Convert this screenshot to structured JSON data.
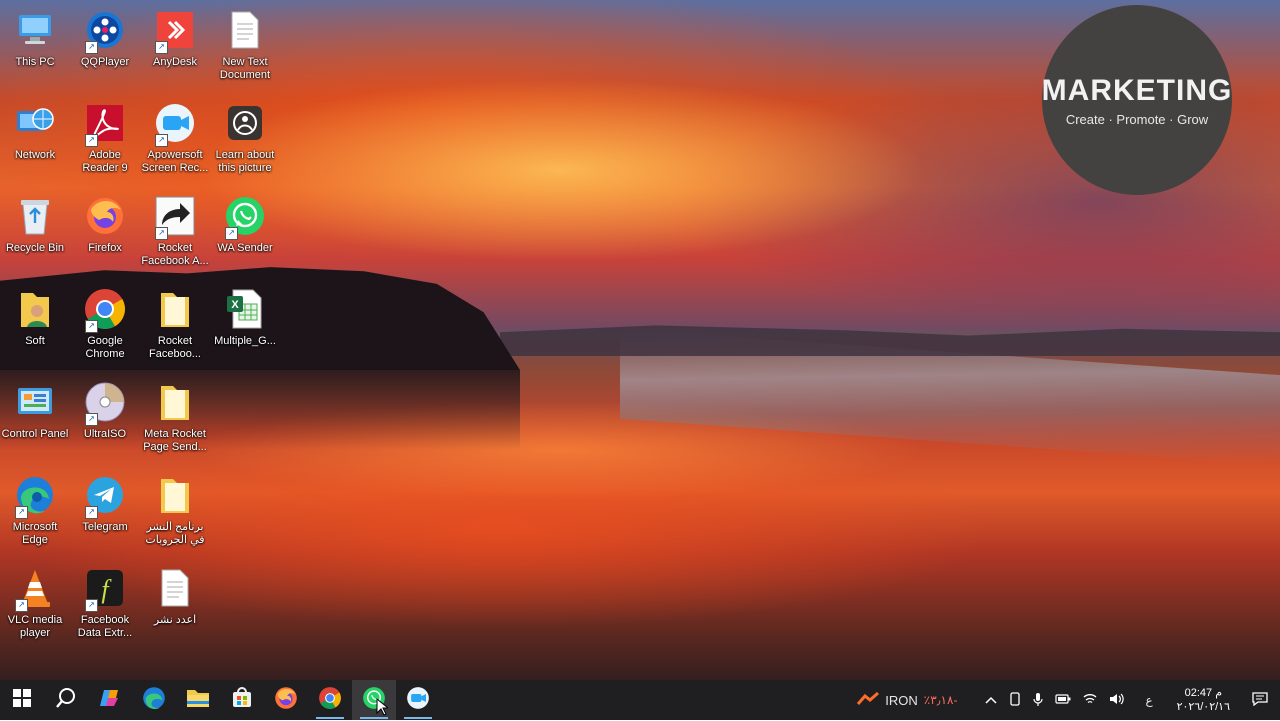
{
  "badge": {
    "title": "MARKETING",
    "subtitle": "Create · Promote · Grow"
  },
  "desktop": {
    "icons": [
      {
        "label": "This PC",
        "icon": "this-pc-icon"
      },
      {
        "label": "QQPlayer",
        "icon": "qqplayer-icon"
      },
      {
        "label": "AnyDesk",
        "icon": "anydesk-icon"
      },
      {
        "label": "New Text Document",
        "icon": "text-document-icon"
      },
      {
        "label": "Network",
        "icon": "network-icon"
      },
      {
        "label": "Adobe Reader 9",
        "icon": "adobe-reader-icon"
      },
      {
        "label": "Apowersoft Screen Rec...",
        "icon": "apowersoft-icon"
      },
      {
        "label": "Learn about this picture",
        "icon": "learn-picture-icon"
      },
      {
        "label": "Recycle Bin",
        "icon": "recycle-bin-icon"
      },
      {
        "label": "Firefox",
        "icon": "firefox-icon"
      },
      {
        "label": "Rocket Facebook A...",
        "icon": "rocket-facebook-icon"
      },
      {
        "label": "WA Sender",
        "icon": "whatsapp-icon"
      },
      {
        "label": "Soft",
        "icon": "folder-icon"
      },
      {
        "label": "Google Chrome",
        "icon": "chrome-icon"
      },
      {
        "label": "Rocket Faceboo...",
        "icon": "folder-icon"
      },
      {
        "label": "Multiple_G...",
        "icon": "excel-file-icon"
      },
      {
        "label": "Control Panel",
        "icon": "control-panel-icon"
      },
      {
        "label": "UltraISO",
        "icon": "ultraiso-icon"
      },
      {
        "label": "Meta Rocket Page Send...",
        "icon": "folder-icon"
      },
      {
        "label": "Microsoft Edge",
        "icon": "edge-icon"
      },
      {
        "label": "Telegram",
        "icon": "telegram-icon"
      },
      {
        "label": "برنامج النشر في الجروبات",
        "icon": "folder-icon"
      },
      {
        "label": "VLC media player",
        "icon": "vlc-icon"
      },
      {
        "label": "Facebook Data Extr...",
        "icon": "facebook-extractor-icon"
      },
      {
        "label": "اعدد نشر",
        "icon": "text-document-icon"
      }
    ]
  },
  "taskbar": {
    "apps": [
      {
        "name": "start",
        "icon": "windows-start-icon"
      },
      {
        "name": "search",
        "icon": "search-icon"
      },
      {
        "name": "copilot",
        "icon": "copilot-icon"
      },
      {
        "name": "edge",
        "icon": "edge-icon"
      },
      {
        "name": "file-explorer",
        "icon": "folder-icon"
      },
      {
        "name": "store",
        "icon": "store-icon"
      },
      {
        "name": "firefox",
        "icon": "firefox-icon"
      },
      {
        "name": "chrome",
        "icon": "chrome-icon"
      },
      {
        "name": "whatsapp",
        "icon": "whatsapp-icon"
      },
      {
        "name": "apowersoft",
        "icon": "apowersoft-icon"
      }
    ],
    "tray": {
      "ticker": "IRON",
      "ticker_change": "٪٣٫١٨-",
      "language": "ع",
      "time": "02:47 م",
      "date": "٢٠٢٦/٠٢/١٦"
    }
  }
}
